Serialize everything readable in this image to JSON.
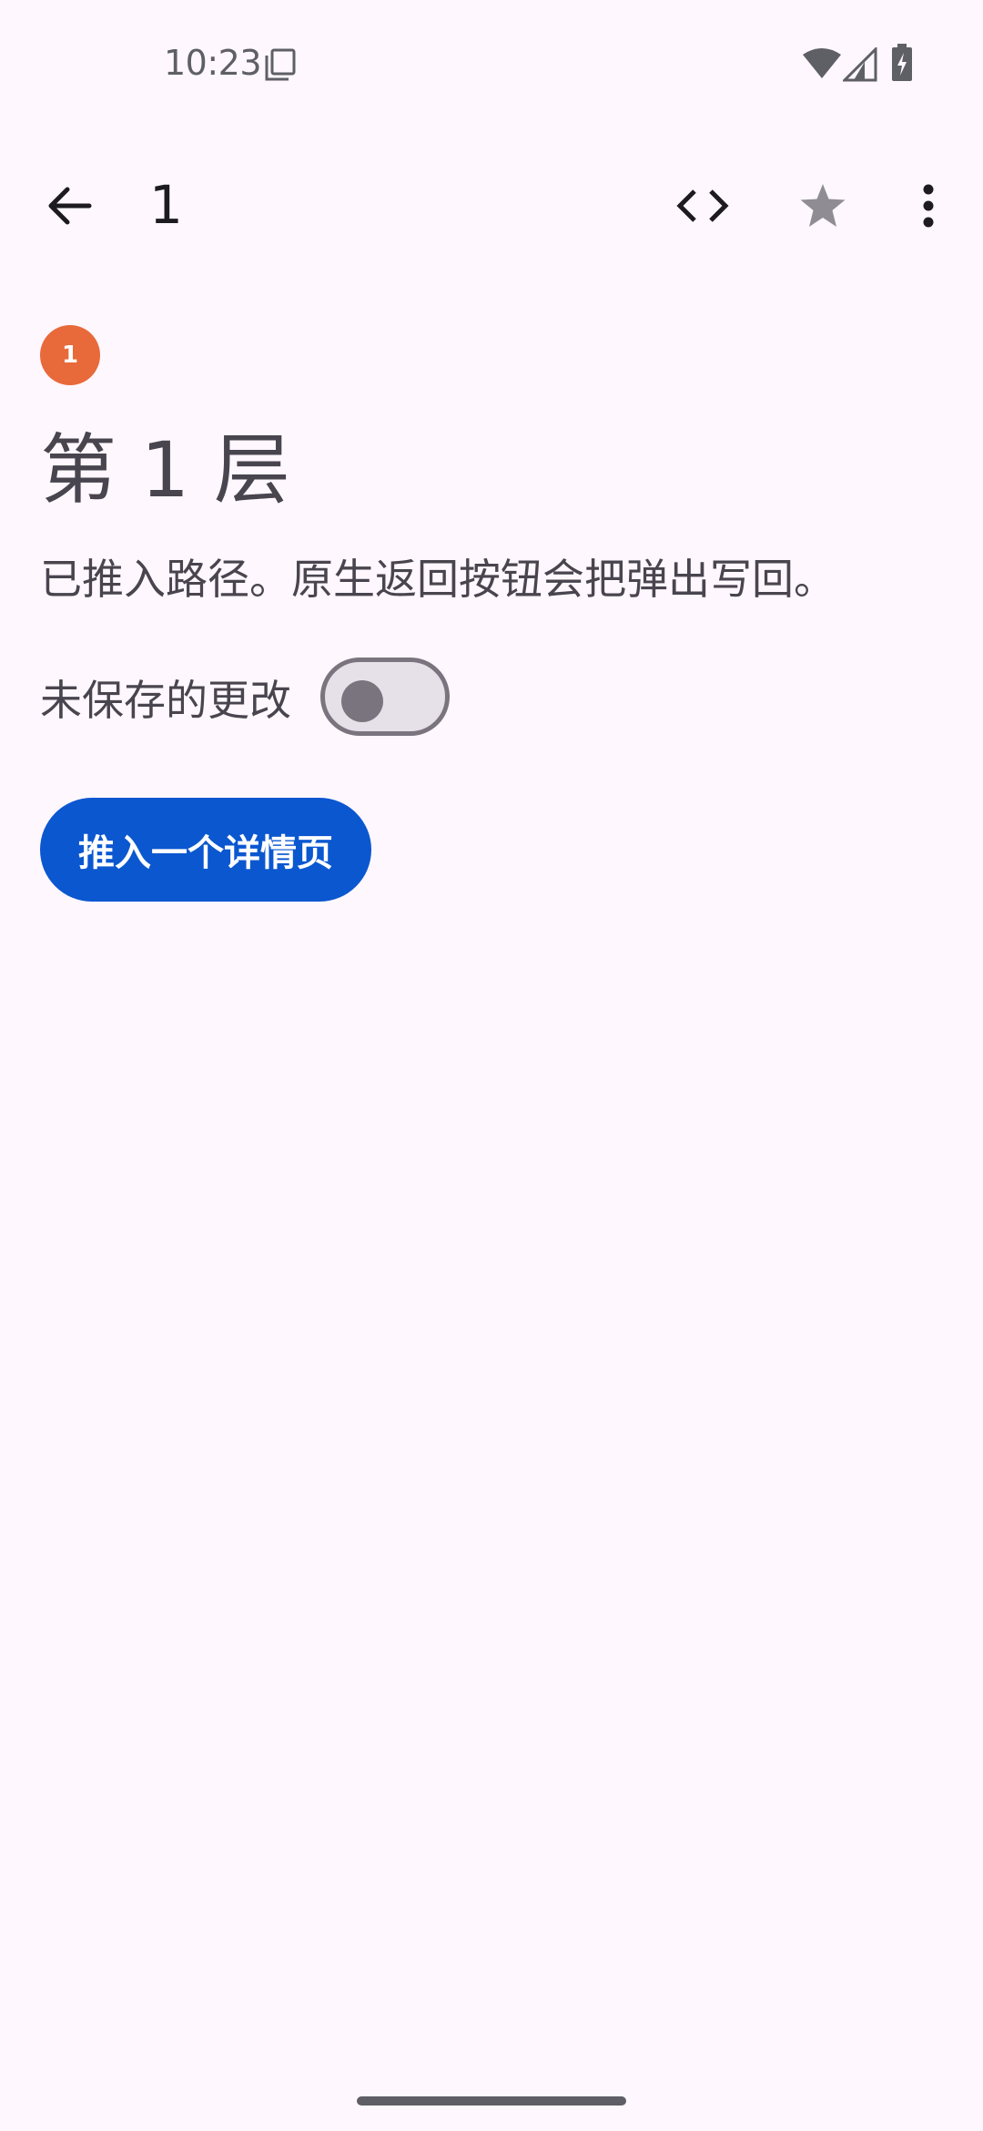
{
  "status_bar": {
    "time": "10:23",
    "icons": [
      "copy-icon",
      "wifi-icon",
      "signal-icon",
      "battery-charging-icon"
    ]
  },
  "app_bar": {
    "title": "1",
    "icons": [
      "back-arrow-icon",
      "code-icon",
      "star-icon",
      "more-vert-icon"
    ]
  },
  "content": {
    "badge": "1",
    "heading": "第 1 层",
    "description": "已推入路径。原生返回按钮会把弹出写回。",
    "unsaved_label": "未保存的更改",
    "unsaved_toggle_on": false,
    "push_button_label": "推入一个详情页"
  },
  "colors": {
    "background": "#fef7fe",
    "badge": "#e8693a",
    "primary_button": "#0b57d0",
    "text": "#49454f"
  }
}
